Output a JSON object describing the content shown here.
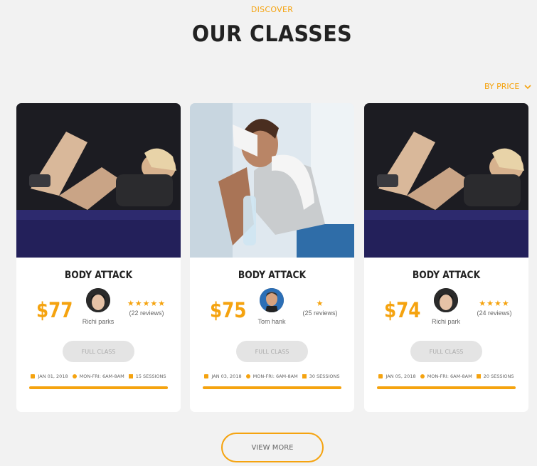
{
  "header": {
    "eyebrow": "DISCOVER",
    "title": "OUR CLASSES"
  },
  "sort": {
    "label": "BY PRICE",
    "icon": "chevron-down-icon"
  },
  "cards": [
    {
      "title": "BODY ATTACK",
      "price": "$77",
      "trainer": "Richi parks",
      "stars": "★★★★★",
      "reviews": "(22 reviews)",
      "button": "FULL CLASS",
      "date": "JAN 01, 2018",
      "schedule": "MON-FRI: 6AM-8AM",
      "sessions": "15 SESSIONS"
    },
    {
      "title": "BODY ATTACK",
      "price": "$75",
      "trainer": "Tom hank",
      "stars": "★",
      "reviews": "(25 reviews)",
      "button": "FULL CLASS",
      "date": "JAN 03, 2018",
      "schedule": "MON-FRI: 6AM-8AM",
      "sessions": "30 SESSIONS"
    },
    {
      "title": "BODY ATTACK",
      "price": "$74",
      "trainer": "Richi park",
      "stars": "★★★★",
      "reviews": "(24 reviews)",
      "button": "FULL CLASS",
      "date": "JAN 05, 2018",
      "schedule": "MON-FRI: 6AM-8AM",
      "sessions": "20 SESSIONS"
    }
  ],
  "footer": {
    "view_more": "VIEW MORE"
  },
  "colors": {
    "accent": "#f5a30f",
    "background": "#f2f2f2"
  }
}
